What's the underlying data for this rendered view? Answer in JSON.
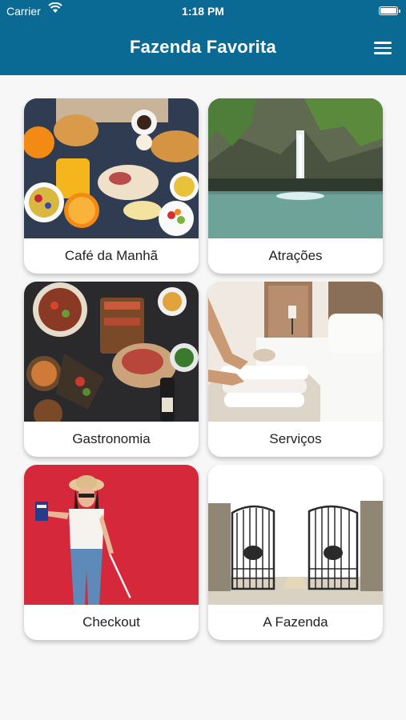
{
  "status_bar": {
    "carrier": "Carrier",
    "time": "1:18 PM"
  },
  "header": {
    "title": "Fazenda Favorita"
  },
  "cards": [
    {
      "label": "Café da Manhã"
    },
    {
      "label": "Atrações"
    },
    {
      "label": "Gastronomia"
    },
    {
      "label": "Serviços"
    },
    {
      "label": "Checkout"
    },
    {
      "label": "A Fazenda"
    }
  ],
  "colors": {
    "header": "#0b6a93",
    "background": "#f7f7f7",
    "card": "#ffffff"
  }
}
